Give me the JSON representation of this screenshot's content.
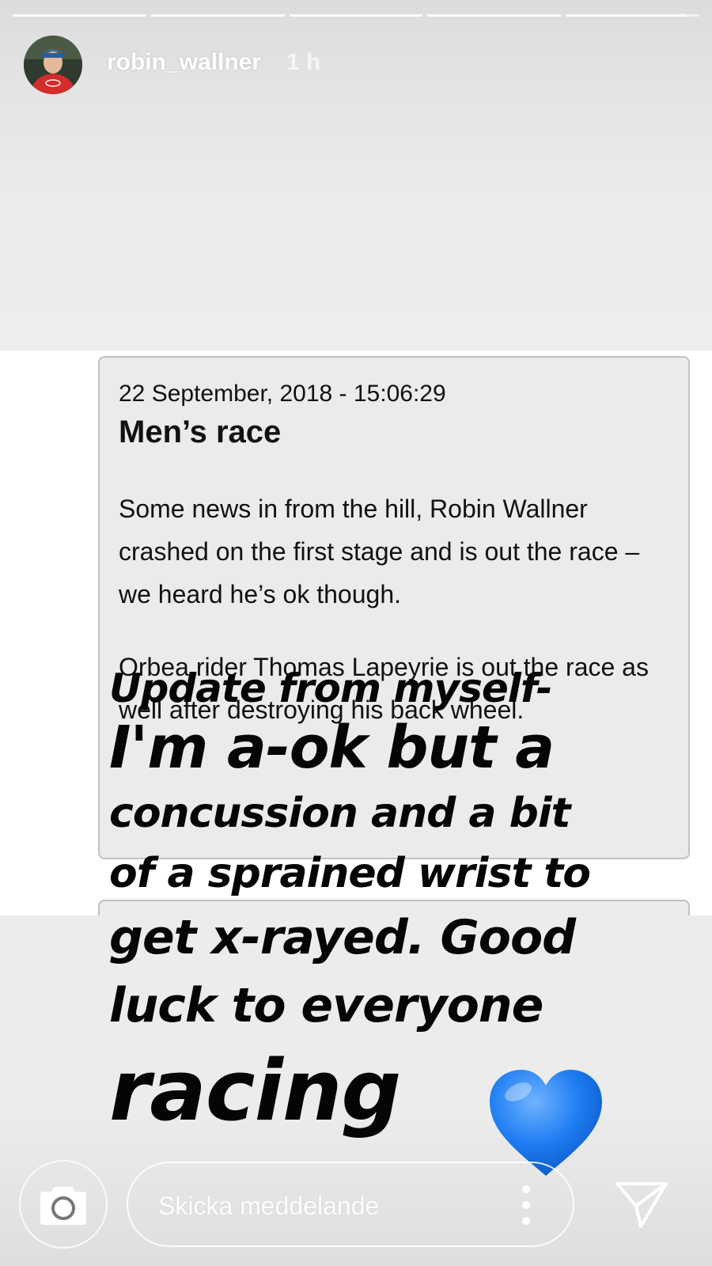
{
  "story": {
    "progress_fractions": [
      1,
      1,
      1,
      1,
      0.9
    ],
    "user": {
      "username": "robin_wallner",
      "time_ago": "1 h"
    }
  },
  "post": {
    "timestamp": "22 September, 2018 - 15:06:29",
    "title": "Men’s race",
    "paragraph1": "Some news in from the hill, Robin Wallner crashed on the first stage and is out the race – we heard he’s ok though.",
    "paragraph2": "Orbea rider Thomas Lapeyrie is out the race as well after destroying his back wheel."
  },
  "overlay_text": {
    "line1": "Update from myself-",
    "line2": "I'm a-ok but a",
    "line3": "concussion and a bit",
    "line4": "of a sprained wrist to",
    "line5": "get x-rayed. Good",
    "line6": "luck to everyone",
    "line7": "racing"
  },
  "heart_emoji": {
    "icon": "blue-heart",
    "color": "#1d7cf2"
  },
  "footer": {
    "message_placeholder": "Skicka meddelande",
    "camera_icon": "camera-icon",
    "more_icon": "more-vertical-icon",
    "send_icon": "send-icon"
  }
}
